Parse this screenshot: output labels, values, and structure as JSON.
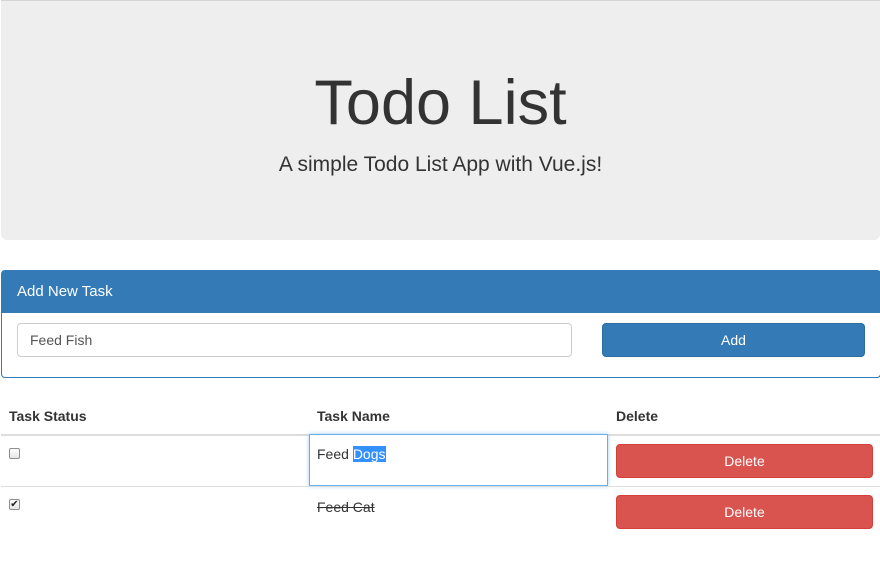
{
  "header": {
    "title": "Todo List",
    "subtitle": "A simple Todo List App with Vue.js!"
  },
  "add_panel": {
    "heading": "Add New Task",
    "input_value": "Feed Fish",
    "add_label": "Add"
  },
  "table": {
    "columns": [
      "Task Status",
      "Task Name",
      "Delete"
    ],
    "rows": [
      {
        "done": false,
        "name_prefix": "Feed ",
        "name_selected": "Dogs",
        "delete_label": "Delete"
      },
      {
        "done": true,
        "name": "Feed Cat",
        "delete_label": "Delete"
      }
    ]
  },
  "colors": {
    "primary": "#337ab7",
    "danger": "#d9534f",
    "jumbotron_bg": "#eeeeee"
  }
}
